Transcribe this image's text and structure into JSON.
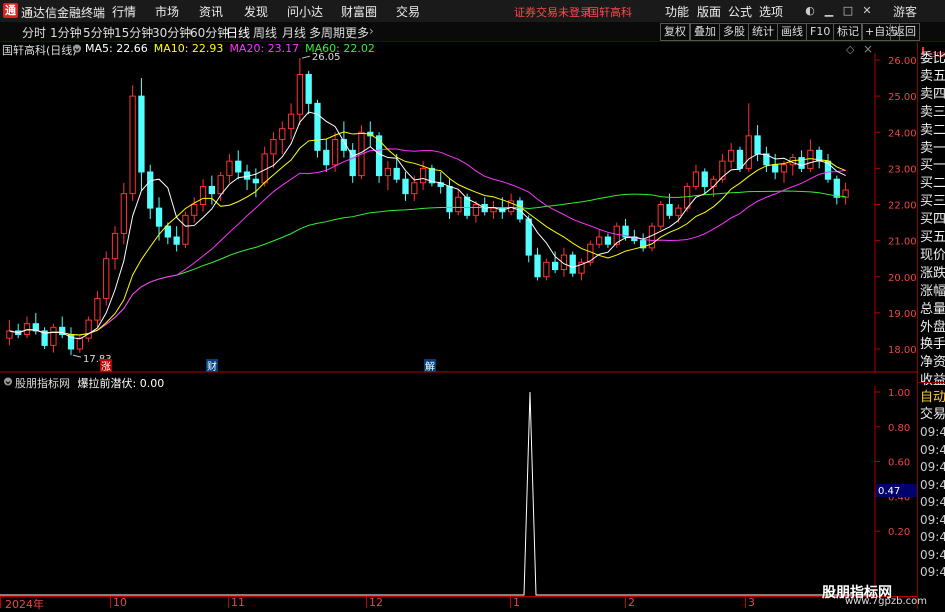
{
  "app": {
    "title": "通达信金融终端",
    "logo": "通"
  },
  "menus": [
    "行情",
    "市场",
    "资讯",
    "发现",
    "问小达",
    "财富圈",
    "交易"
  ],
  "notice": {
    "a": "证券交易未登录",
    "b": "国轩高科"
  },
  "right_menus": [
    "功能",
    "版面",
    "公式",
    "选项"
  ],
  "guest": "游客",
  "periods": [
    "分时",
    "1分钟",
    "5分钟",
    "15分钟",
    "30分钟",
    "60分钟",
    "日线",
    "周线",
    "月线",
    "多周期",
    "更多"
  ],
  "active_period": "日线",
  "tool_buttons": [
    "复权",
    "叠加",
    "多股",
    "统计",
    "画线",
    "F10",
    "标记",
    "+自选",
    "返回"
  ],
  "colors": {
    "up": "#ff3232",
    "down": "#54ffff",
    "ma5": "#ffffff",
    "ma10": "#ffff00",
    "ma20": "#ff33ff",
    "ma60": "#33ee33",
    "axis": "#b00000"
  },
  "main_chart": {
    "stock": "国轩高科(日线)",
    "ma_labels": [
      {
        "text": "MA5: 22.66",
        "color": "#ffffff"
      },
      {
        "text": "MA10: 22.93",
        "color": "#ffff00"
      },
      {
        "text": "MA20: 23.17",
        "color": "#ff33ff"
      },
      {
        "text": "MA60: 22.02",
        "color": "#33ee33"
      }
    ],
    "high_label": "26.05",
    "low_label": "17.83",
    "events": [
      {
        "text": "涨"
      },
      {
        "text": "财"
      },
      {
        "text": "解"
      }
    ],
    "y_ticks": [
      "26.00",
      "25.00",
      "24.00",
      "23.00",
      "22.00",
      "21.00",
      "20.00",
      "19.00",
      "18.00"
    ],
    "price_range": [
      17.5,
      26.6
    ]
  },
  "sub_chart": {
    "indicator": "股朋指标网",
    "label": "爆拉前潜伏: 0.00",
    "y_ticks": [
      "1.00",
      "0.80",
      "0.60",
      "0.40",
      "0.20"
    ],
    "cur_value": "0.47"
  },
  "x_axis": [
    "2024年",
    "10",
    "11",
    "12",
    "1",
    "2",
    "3"
  ],
  "right_panel": {
    "badge": "L",
    "badge_sub": "300",
    "items": [
      "委比",
      "卖五",
      "卖四",
      "卖三",
      "卖二",
      "卖一",
      "买一",
      "买二",
      "买三",
      "买四",
      "买五",
      "现价",
      "涨跌",
      "涨幅",
      "总量",
      "外盘",
      "换手",
      "净资",
      "收益"
    ],
    "auto": "自动",
    "trade": "交易",
    "times": [
      "09:43",
      "09:43",
      "09:43",
      "09:43",
      "09:43",
      "09:43",
      "09:43",
      "09:43",
      "09:43"
    ]
  },
  "watermark": {
    "line1": "股朋指标网",
    "line2": "www.7gpzb.com"
  },
  "chart_data": {
    "type": "candlestick",
    "ohlc": [
      [
        18.3,
        18.8,
        18.1,
        18.5
      ],
      [
        18.5,
        18.7,
        18.3,
        18.4
      ],
      [
        18.4,
        18.9,
        18.3,
        18.7
      ],
      [
        18.7,
        19.0,
        18.4,
        18.5
      ],
      [
        18.5,
        18.6,
        18.0,
        18.1
      ],
      [
        18.1,
        18.7,
        17.9,
        18.6
      ],
      [
        18.6,
        18.9,
        18.3,
        18.4
      ],
      [
        18.4,
        18.6,
        17.83,
        18.0
      ],
      [
        18.0,
        18.4,
        17.9,
        18.3
      ],
      [
        18.3,
        18.9,
        18.2,
        18.8
      ],
      [
        18.8,
        19.6,
        18.6,
        19.4
      ],
      [
        19.4,
        20.7,
        19.2,
        20.5
      ],
      [
        20.5,
        21.4,
        20.2,
        21.2
      ],
      [
        21.2,
        22.6,
        20.9,
        22.3
      ],
      [
        22.3,
        25.3,
        22.1,
        25.0
      ],
      [
        25.0,
        25.5,
        22.4,
        22.9
      ],
      [
        22.9,
        23.1,
        21.6,
        21.9
      ],
      [
        21.9,
        22.2,
        21.0,
        21.4
      ],
      [
        21.4,
        21.5,
        20.9,
        21.1
      ],
      [
        21.1,
        21.4,
        20.7,
        20.9
      ],
      [
        20.9,
        21.8,
        20.8,
        21.7
      ],
      [
        21.7,
        22.2,
        21.5,
        22.0
      ],
      [
        22.0,
        22.7,
        21.8,
        22.5
      ],
      [
        22.5,
        22.8,
        22.0,
        22.3
      ],
      [
        22.3,
        22.9,
        22.1,
        22.8
      ],
      [
        22.8,
        23.4,
        22.6,
        23.2
      ],
      [
        23.2,
        23.5,
        22.7,
        22.9
      ],
      [
        22.9,
        23.1,
        22.4,
        22.7
      ],
      [
        22.7,
        23.0,
        22.2,
        22.6
      ],
      [
        22.6,
        23.6,
        22.5,
        23.4
      ],
      [
        23.4,
        24.0,
        23.0,
        23.8
      ],
      [
        23.8,
        24.3,
        23.4,
        24.1
      ],
      [
        24.1,
        24.8,
        23.8,
        24.5
      ],
      [
        24.5,
        26.05,
        24.2,
        25.6
      ],
      [
        25.6,
        25.7,
        24.5,
        24.8
      ],
      [
        24.8,
        24.9,
        23.3,
        23.5
      ],
      [
        23.5,
        23.8,
        22.9,
        23.1
      ],
      [
        23.1,
        24.0,
        22.9,
        23.8
      ],
      [
        23.8,
        24.3,
        23.3,
        23.5
      ],
      [
        23.5,
        23.7,
        22.6,
        22.8
      ],
      [
        22.8,
        24.2,
        22.7,
        24.0
      ],
      [
        24.0,
        24.3,
        23.6,
        23.9
      ],
      [
        23.9,
        24.0,
        22.6,
        22.8
      ],
      [
        22.8,
        23.2,
        22.4,
        23.0
      ],
      [
        23.0,
        23.4,
        22.6,
        22.7
      ],
      [
        22.7,
        22.9,
        22.1,
        22.3
      ],
      [
        22.3,
        22.8,
        22.1,
        22.6
      ],
      [
        22.6,
        23.2,
        22.4,
        23.0
      ],
      [
        23.0,
        23.1,
        22.5,
        22.6
      ],
      [
        22.6,
        22.9,
        22.3,
        22.5
      ],
      [
        22.5,
        22.7,
        21.6,
        21.8
      ],
      [
        21.8,
        22.4,
        21.7,
        22.2
      ],
      [
        22.2,
        22.3,
        21.6,
        21.7
      ],
      [
        21.7,
        22.1,
        21.5,
        22.0
      ],
      [
        22.0,
        22.2,
        21.7,
        21.8
      ],
      [
        21.8,
        22.1,
        21.6,
        21.9
      ],
      [
        21.9,
        22.2,
        21.6,
        21.8
      ],
      [
        21.8,
        22.3,
        21.7,
        22.1
      ],
      [
        22.1,
        22.2,
        21.5,
        21.6
      ],
      [
        21.6,
        21.7,
        20.4,
        20.6
      ],
      [
        20.6,
        20.8,
        19.9,
        20.0
      ],
      [
        20.0,
        20.5,
        19.9,
        20.4
      ],
      [
        20.4,
        20.7,
        20.1,
        20.2
      ],
      [
        20.2,
        20.8,
        20.0,
        20.6
      ],
      [
        20.6,
        20.7,
        20.0,
        20.1
      ],
      [
        20.1,
        20.5,
        19.9,
        20.4
      ],
      [
        20.4,
        21.0,
        20.3,
        20.9
      ],
      [
        20.9,
        21.3,
        20.8,
        21.1
      ],
      [
        21.1,
        21.2,
        20.8,
        20.9
      ],
      [
        20.9,
        21.5,
        20.8,
        21.4
      ],
      [
        21.4,
        21.6,
        21.0,
        21.1
      ],
      [
        21.1,
        21.3,
        20.9,
        21.0
      ],
      [
        21.0,
        21.2,
        20.7,
        20.8
      ],
      [
        20.8,
        21.5,
        20.7,
        21.4
      ],
      [
        21.4,
        22.1,
        21.3,
        22.0
      ],
      [
        22.0,
        22.3,
        21.6,
        21.7
      ],
      [
        21.7,
        22.0,
        21.5,
        21.9
      ],
      [
        21.9,
        22.6,
        21.8,
        22.5
      ],
      [
        22.5,
        23.1,
        22.4,
        22.9
      ],
      [
        22.9,
        23.0,
        22.3,
        22.5
      ],
      [
        22.5,
        22.8,
        22.2,
        22.7
      ],
      [
        22.7,
        23.4,
        22.6,
        23.2
      ],
      [
        23.2,
        23.7,
        23.0,
        23.5
      ],
      [
        23.5,
        23.6,
        22.9,
        23.0
      ],
      [
        23.0,
        24.8,
        22.9,
        23.9
      ],
      [
        23.9,
        24.2,
        23.2,
        23.4
      ],
      [
        23.4,
        23.6,
        22.9,
        23.1
      ],
      [
        23.1,
        23.4,
        22.7,
        22.9
      ],
      [
        22.9,
        23.2,
        22.6,
        23.1
      ],
      [
        23.1,
        23.4,
        22.8,
        23.3
      ],
      [
        23.3,
        23.5,
        22.9,
        23.0
      ],
      [
        23.0,
        23.8,
        22.9,
        23.5
      ],
      [
        23.5,
        23.6,
        23.0,
        23.2
      ],
      [
        23.2,
        23.4,
        22.6,
        22.7
      ],
      [
        22.7,
        22.8,
        22.0,
        22.2
      ],
      [
        22.2,
        22.6,
        22.0,
        22.4
      ]
    ],
    "ma_last": {
      "ma5": 22.66,
      "ma10": 22.93,
      "ma20": 23.17,
      "ma60": 22.02
    },
    "indicator": {
      "name": "爆拉前潜伏",
      "spike_index": 67,
      "spike_value": 1.0,
      "last": 0.0
    }
  }
}
